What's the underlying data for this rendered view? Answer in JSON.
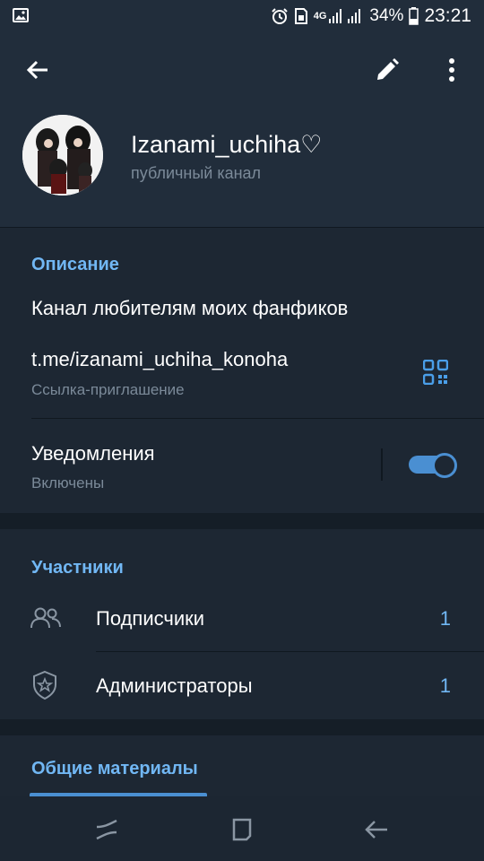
{
  "status_bar": {
    "battery": "34%",
    "time": "23:21",
    "network": "4G",
    "icons": [
      "image-icon",
      "alarm-icon",
      "sim-icon",
      "signal-icon",
      "battery-icon"
    ]
  },
  "app_bar": {
    "icons": [
      "back-arrow-icon",
      "pencil-icon",
      "more-vertical-icon"
    ]
  },
  "channel": {
    "name": "Izanami_uchiha♡",
    "type": "публичный канал"
  },
  "info": {
    "section_title": "Описание",
    "description": "Канал любителям моих фанфиков",
    "link": "t.me/izanami_uchiha_konoha",
    "link_caption": "Ссылка-приглашение",
    "notifications_label": "Уведомления",
    "notifications_state": "Включены",
    "notifications_on": true
  },
  "members": {
    "section_title": "Участники",
    "items": [
      {
        "label": "Подписчики",
        "count": "1",
        "icon": "users-icon"
      },
      {
        "label": "Администраторы",
        "count": "1",
        "icon": "admin-shield-icon"
      }
    ]
  },
  "shared": {
    "section_title": "Общие материалы"
  },
  "colors": {
    "background": "#1d2733",
    "header": "#212d3b",
    "accent": "#71b7f4",
    "toggle": "#4a8fd2",
    "secondary_text": "#7b8a99"
  }
}
